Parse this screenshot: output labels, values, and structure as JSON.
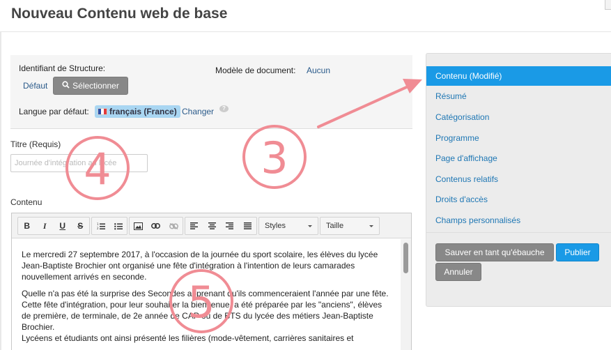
{
  "header": {
    "title": "Nouveau Contenu web de base"
  },
  "structure": {
    "identifiant_label": "Identifiant de Structure:",
    "default_link": "Défaut",
    "select_button": "Sélectionner",
    "template_label": "Modèle de document:",
    "template_value": "Aucun",
    "language_label": "Langue par défaut:",
    "language_value": "français (France)",
    "change_link": "Changer",
    "help_glyph": "?"
  },
  "title_field": {
    "label": "Titre (Requis)",
    "value": "Journée d'intégration au lycée"
  },
  "content_field": {
    "label": "Contenu"
  },
  "toolbar": {
    "bold": "B",
    "italic": "I",
    "underline": "U",
    "strike": "S",
    "styles_label": "Styles",
    "size_label": "Taille"
  },
  "editor": {
    "paragraphs": [
      "Le mercredi 27 septembre 2017, à l'occasion de la journée du sport scolaire, les élèves du lycée Jean-Baptiste Brochier ont organisé une fête d'intégration à l'intention de leurs camarades nouvellement arrivés en seconde.",
      "Quelle n'a pas été la surprise des Secondes apprenant qu'ils commenceraient l'année par une fête. Cette fête d'intégration, pour leur souhaiter la bienvenue, a été préparée par les \"anciens\", élèves de première, de terminale, de 2e année de CAP ou de BTS du lycée des métiers Jean-Baptiste Brochier.",
      "Lycéens et étudiants ont ainsi présenté les filières (mode-vêtement, carrières sanitaires et"
    ]
  },
  "sidebar": {
    "items": [
      {
        "label": "Contenu (Modifié)",
        "active": true
      },
      {
        "label": "Résumé",
        "active": false
      },
      {
        "label": "Catégorisation",
        "active": false
      },
      {
        "label": "Programme",
        "active": false
      },
      {
        "label": "Page d'affichage",
        "active": false
      },
      {
        "label": "Contenus relatifs",
        "active": false
      },
      {
        "label": "Droits d'accès",
        "active": false
      },
      {
        "label": "Champs personnalisés",
        "active": false
      }
    ],
    "save_draft": "Sauver en tant qu'ébauche",
    "publish": "Publier",
    "cancel": "Annuler"
  },
  "annotations": {
    "three": "3",
    "four": "4",
    "five": "5"
  },
  "colors": {
    "accent": "#1a9ae6",
    "link": "#1f77b4",
    "annotation": "#f08c94",
    "button_grey": "#888888"
  }
}
